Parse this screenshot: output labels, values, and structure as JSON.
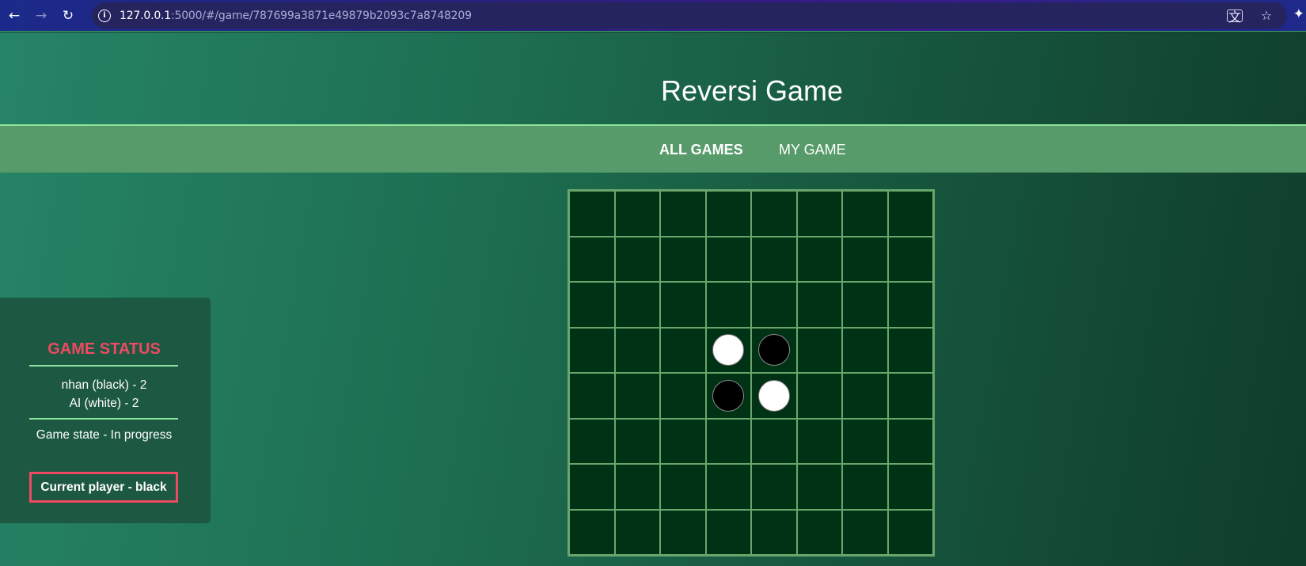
{
  "browser": {
    "url_host": "127.0.0.1",
    "url_rest": ":5000/#/game/787699a3871e49879b2093c7a8748209"
  },
  "header": {
    "title": "Reversi Game"
  },
  "nav": {
    "all_games": "ALL GAMES",
    "my_game": "MY GAME"
  },
  "status": {
    "title": "GAME STATUS",
    "player1": "nhan (black) - 2",
    "player2": "AI (white) - 2",
    "game_state": "Game state - In progress",
    "current_player": "Current player - black"
  },
  "board": {
    "size": 8,
    "discs": [
      {
        "row": 3,
        "col": 3,
        "color": "white"
      },
      {
        "row": 3,
        "col": 4,
        "color": "black"
      },
      {
        "row": 4,
        "col": 3,
        "color": "black"
      },
      {
        "row": 4,
        "col": 4,
        "color": "white"
      }
    ]
  },
  "colors": {
    "accent_red": "#ee4a62",
    "accent_green": "#8ee39a",
    "board_bg": "#003215",
    "nav_bg": "#569b69"
  }
}
